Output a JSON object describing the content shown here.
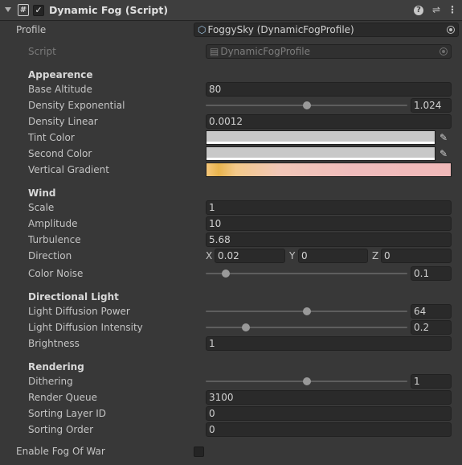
{
  "header": {
    "title": "Dynamic Fog (Script)",
    "enabled": true
  },
  "profile": {
    "label": "Profile",
    "value": "FoggySky (DynamicFogProfile)"
  },
  "script": {
    "label": "Script",
    "value": "DynamicFogProfile"
  },
  "appearance": {
    "title": "Appearence",
    "base_altitude": {
      "label": "Base Altitude",
      "value": "80"
    },
    "density_exponential": {
      "label": "Density Exponential",
      "value": "1.024",
      "fraction": 0.5
    },
    "density_linear": {
      "label": "Density Linear",
      "value": "0.0012"
    },
    "tint_color": {
      "label": "Tint Color",
      "color": "#c8c8c8"
    },
    "second_color": {
      "label": "Second Color",
      "color": "#c8c8c8"
    },
    "vertical_gradient": {
      "label": "Vertical Gradient"
    }
  },
  "wind": {
    "title": "Wind",
    "scale": {
      "label": "Scale",
      "value": "1"
    },
    "amplitude": {
      "label": "Amplitude",
      "value": "10"
    },
    "turbulence": {
      "label": "Turbulence",
      "value": "5.68"
    },
    "direction": {
      "label": "Direction",
      "x_label": "X",
      "x": "0.02",
      "y_label": "Y",
      "y": "0",
      "z_label": "Z",
      "z": "0"
    },
    "color_noise": {
      "label": "Color Noise",
      "value": "0.1",
      "fraction": 0.1
    }
  },
  "directional_light": {
    "title": "Directional Light",
    "diffusion_power": {
      "label": "Light Diffusion Power",
      "value": "64",
      "fraction": 0.5
    },
    "diffusion_intensity": {
      "label": "Light Diffusion Intensity",
      "value": "0.2",
      "fraction": 0.2
    },
    "brightness": {
      "label": "Brightness",
      "value": "1"
    }
  },
  "rendering": {
    "title": "Rendering",
    "dithering": {
      "label": "Dithering",
      "value": "1",
      "fraction": 0.5
    },
    "render_queue": {
      "label": "Render Queue",
      "value": "3100"
    },
    "sorting_layer_id": {
      "label": "Sorting Layer ID",
      "value": "0"
    },
    "sorting_order": {
      "label": "Sorting Order",
      "value": "0"
    }
  },
  "fog_of_war": {
    "label": "Enable Fog Of War",
    "enabled": false
  },
  "icons": {
    "help": "?",
    "preset": "⇌",
    "menu": "⋮",
    "script": "#",
    "check": "✓",
    "eyedropper": "✎"
  }
}
